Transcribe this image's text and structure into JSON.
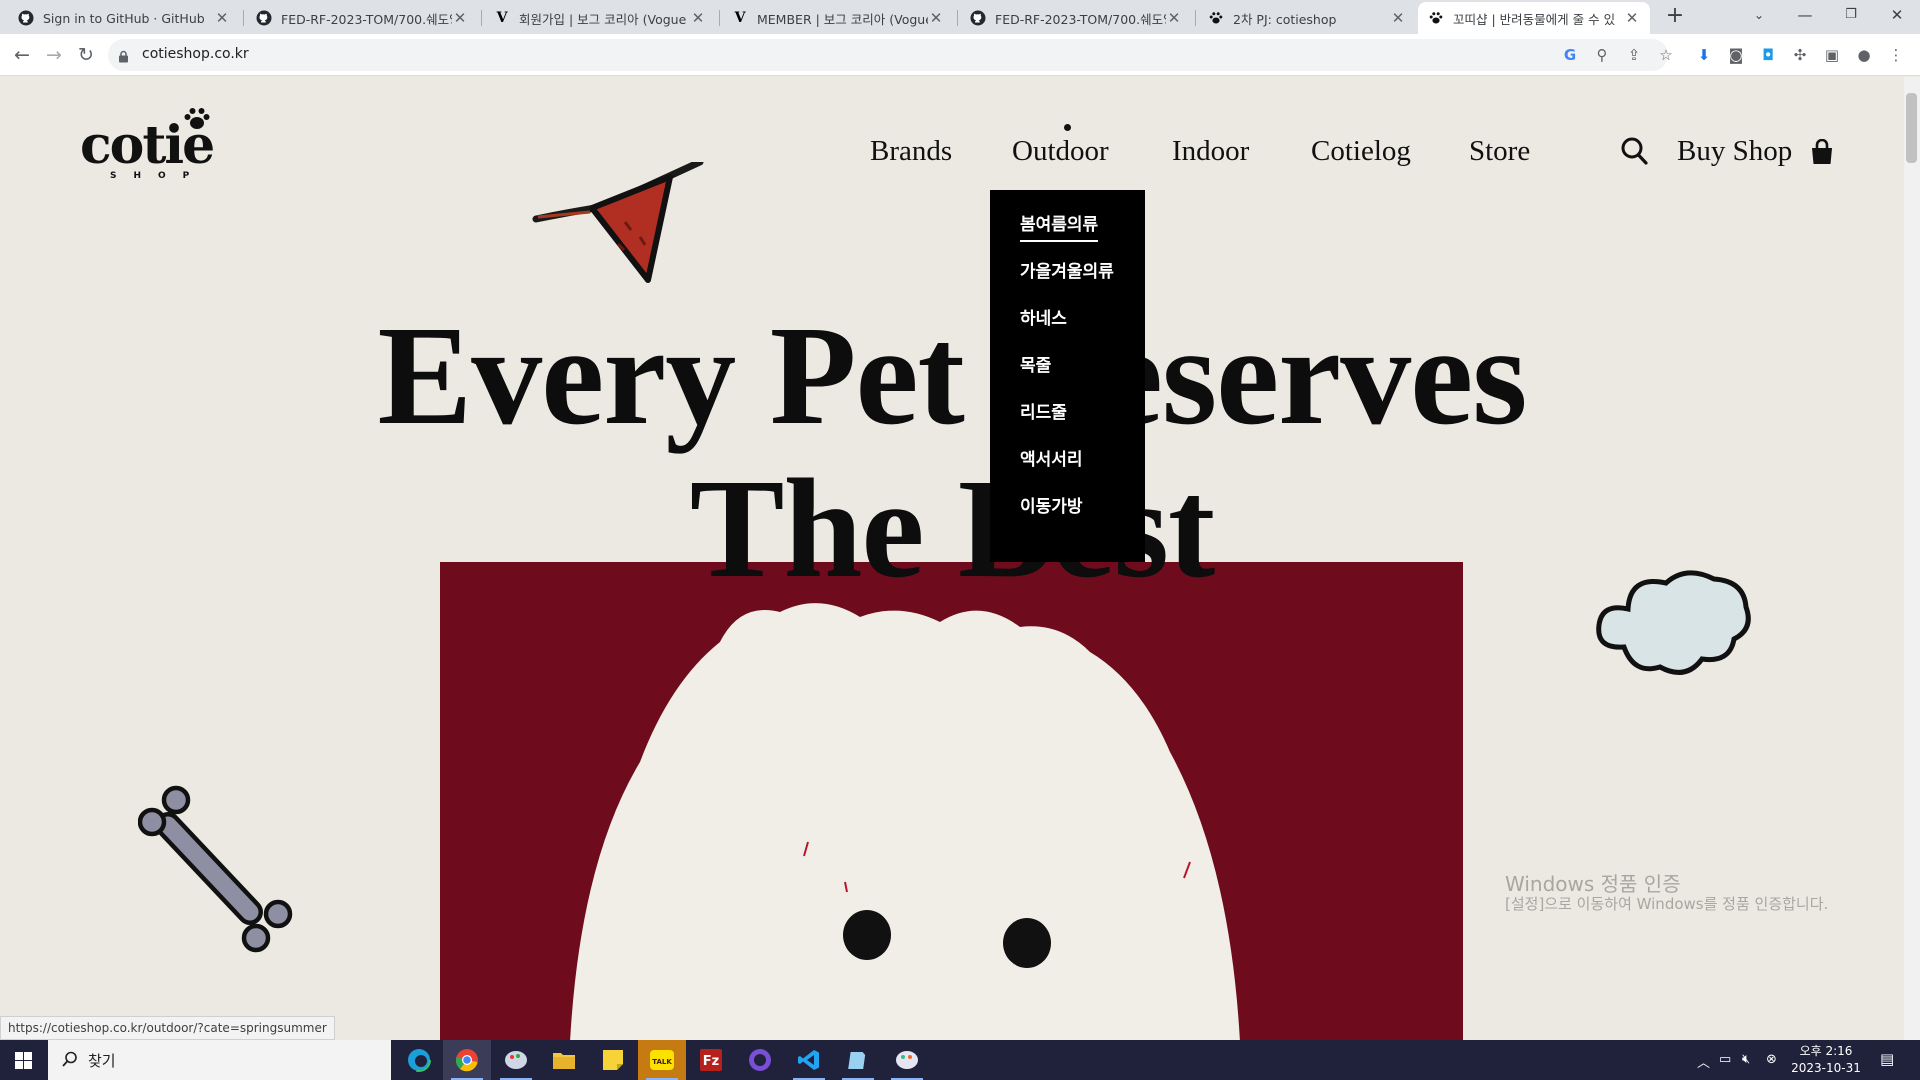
{
  "browser": {
    "tabs": [
      {
        "title": "Sign in to GitHub · GitHub",
        "icon": "github-icon"
      },
      {
        "title": "FED-RF-2023-TOM/700.쉐도잉",
        "icon": "github-icon"
      },
      {
        "title": "회원가입 | 보그 코리아 (Vogue",
        "icon": "vogue-icon"
      },
      {
        "title": "MEMBER | 보그 코리아 (Vogue",
        "icon": "vogue-icon"
      },
      {
        "title": "FED-RF-2023-TOM/700.쉐도잉",
        "icon": "github-icon"
      },
      {
        "title": "2차 PJ: cotieshop",
        "icon": "paw-icon"
      },
      {
        "title": "꼬띠샵 | 반려동물에게 줄 수 있",
        "icon": "paw-icon",
        "active": true
      }
    ],
    "url": "cotieshop.co.kr",
    "status_url": "https://cotieshop.co.kr/outdoor/?cate=springsummer"
  },
  "site": {
    "logo_text": "cotie",
    "logo_sub": "SHOP",
    "nav": [
      "Brands",
      "Outdoor",
      "Indoor",
      "Cotielog",
      "Store"
    ],
    "buy_shop": "Buy Shop",
    "hero_line1": "Every Pet Deserves",
    "hero_line2": "The Best",
    "dropdown": [
      "봄여름의류",
      "가을겨울의류",
      "하네스",
      "목줄",
      "리드줄",
      "액서서리",
      "이동가방"
    ],
    "dropdown_active_index": 0
  },
  "watermark": {
    "line1": "Windows 정품 인증",
    "line2": "[설정]으로 이동하여 Windows를 정품 인증합니다."
  },
  "taskbar": {
    "search_placeholder": "찾기",
    "time": "오후 2:16",
    "date": "2023-10-31"
  },
  "colors": {
    "page_bg": "#ece9e3",
    "hero_red": "#6e0c1d",
    "dropdown_bg": "#000000",
    "taskbar_bg": "#20213a"
  }
}
